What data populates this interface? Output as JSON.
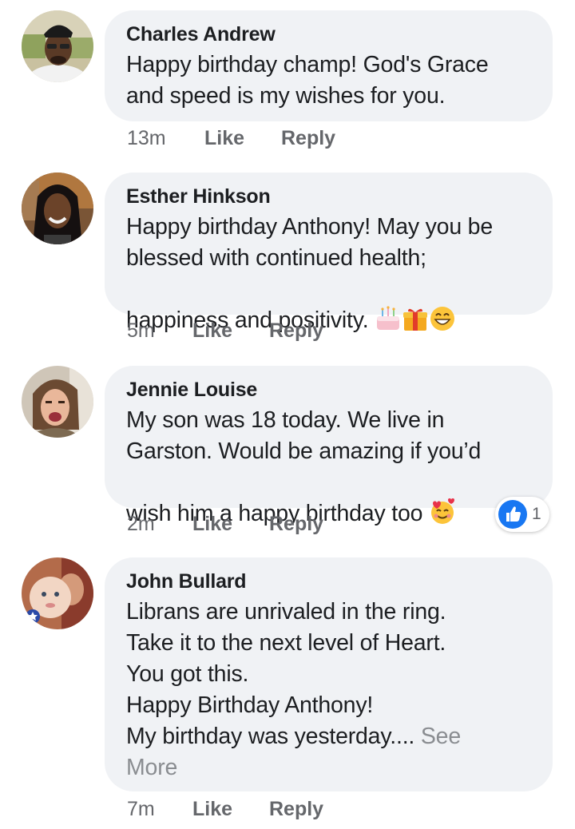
{
  "comments": [
    {
      "author": "Charles Andrew",
      "text": "Happy birthday champ! God's Grace\nand speed is my wishes for you.",
      "time": "13m",
      "like": "Like",
      "reply": "Reply"
    },
    {
      "author": "Esther Hinkson",
      "text": "Happy birthday Anthony! May you be\nblessed with continued health;\nhappiness and positivity. ",
      "emojis": [
        "birthday-cake",
        "wrapped-gift",
        "grinning-face"
      ],
      "time": "5m",
      "like": "Like",
      "reply": "Reply"
    },
    {
      "author": "Jennie Louise",
      "text": "My son was 18 today. We live in\nGarston. Would be amazing if you’d\nwish him a happy birthday too ",
      "emojis": [
        "smiling-face-with-hearts"
      ],
      "time": "2m",
      "like": "Like",
      "reply": "Reply",
      "reaction": {
        "icon": "like-icon",
        "count": "1"
      }
    },
    {
      "author": "John Bullard",
      "text": "Librans are unrivaled in the ring.\nTake it to the next level of Heart.\nYou got this.\nHappy Birthday Anthony!\nMy birthday was yesterday.... ",
      "see_more": "See\nMore",
      "time": "7m",
      "like": "Like",
      "reply": "Reply"
    }
  ],
  "colors": {
    "bubble": "#f0f2f5",
    "text": "#1c1e21",
    "meta": "#65676b",
    "like_blue": "#1877f2"
  }
}
